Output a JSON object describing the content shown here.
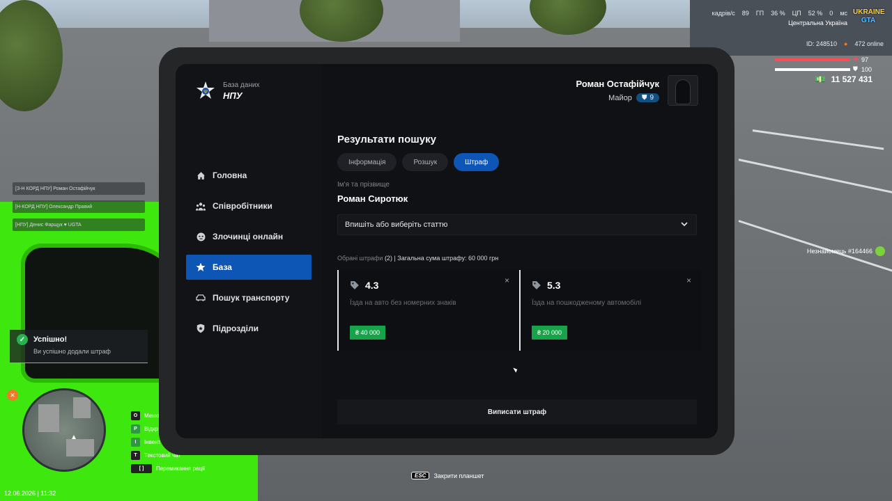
{
  "hud": {
    "fps_label": "кадрів/с",
    "fps_value": "89",
    "gp_label": "ГП",
    "gp_value": "36 %",
    "cp_label": "ЦП",
    "cp_value": "52 %",
    "ping_label": "мс",
    "ping_value": "0",
    "region": "Центральна Україна",
    "brand_line1": "UKRAINE",
    "brand_line2": "GTA",
    "player_id": "ID: 248510",
    "online": "472 online",
    "health": "97",
    "armor": "100",
    "money": "11 527 431",
    "stranger_tag": "Незнайомець #164466",
    "esc_key": "ESC",
    "esc_text": "Закрити планшет",
    "datetime": "12.06.2026 | 11:32"
  },
  "chat": [
    {
      "text": "[З-Н КОРД НПУ] Роман Остафійчук"
    },
    {
      "text": "[Н-КОРД НПУ] Олександр Правий"
    },
    {
      "text": "[НПУ] Денис Фарщук   ♥ UGTA"
    }
  ],
  "notification": {
    "title": "Успішно!",
    "text": "Ви успішно додали штраф"
  },
  "keybinds": [
    {
      "key": "O",
      "label": "Меню",
      "green": false
    },
    {
      "key": "P",
      "label": "Відкр",
      "green": true
    },
    {
      "key": "I",
      "label": "Інвент",
      "green": true
    },
    {
      "key": "T",
      "label": "Текстовий чат",
      "green": false
    },
    {
      "key": "[ ]",
      "label": "Перемикання рації",
      "green": false
    }
  ],
  "tablet": {
    "logo": {
      "top": "База даних",
      "bottom": "НПУ"
    },
    "user": {
      "name": "Роман Остафійчук",
      "rank": "Майор",
      "level": "9"
    },
    "nav": [
      {
        "label": "Головна",
        "icon": "home-icon",
        "active": false
      },
      {
        "label": "Співробітники",
        "icon": "people-icon",
        "active": false
      },
      {
        "label": "Злочинці онлайн",
        "icon": "criminal-icon",
        "active": false
      },
      {
        "label": "База",
        "icon": "star-icon",
        "active": true
      },
      {
        "label": "Пошук транспорту",
        "icon": "car-icon",
        "active": false
      },
      {
        "label": "Підрозділи",
        "icon": "shield-icon",
        "active": false
      }
    ],
    "title": "Результати пошуку",
    "tabs": [
      {
        "label": "Інформація",
        "active": false
      },
      {
        "label": "Розшук",
        "active": false
      },
      {
        "label": "Штраф",
        "active": true
      }
    ],
    "name_label": "Ім'я та прізвище",
    "person_name": "Роман Сиротюк",
    "select_placeholder": "Впишіть або виберіть статтю",
    "summary_muted": "Обрані штрафи",
    "summary_count": "(2)",
    "summary_total": "| Загальна сума штрафу: 60 000 грн",
    "fines": [
      {
        "article": "4.3",
        "description": "Їзда на авто без номерних знаків",
        "amount": "₴ 40 000"
      },
      {
        "article": "5.3",
        "description": "Їзда на пошкодженому автомобілі",
        "amount": "₴ 20 000"
      }
    ],
    "close_symbol": "×",
    "submit_label": "Виписати штраф"
  }
}
